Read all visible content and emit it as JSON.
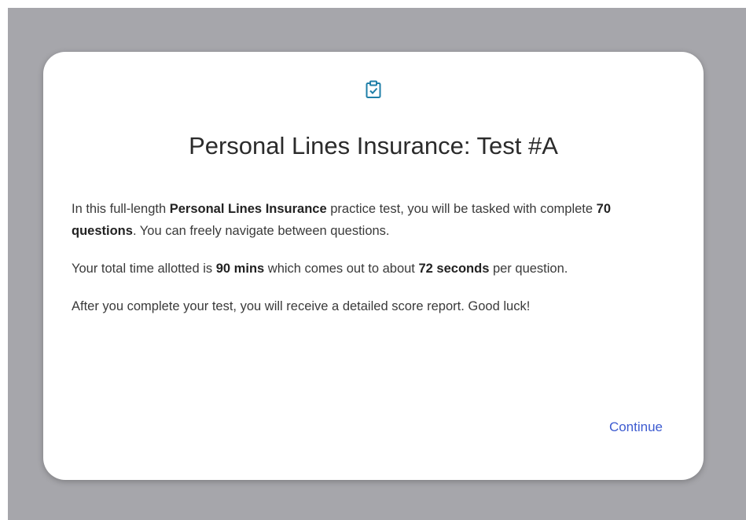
{
  "modal": {
    "icon": "clipboard-check-icon",
    "title": "Personal Lines Insurance: Test #A",
    "p1": {
      "t1": "In this full-length ",
      "b1": "Personal Lines Insurance",
      "t2": " practice test, you will be tasked with complete ",
      "b2": "70 questions",
      "t3": ". You can freely navigate between questions."
    },
    "p2": {
      "t1": "Your total time allotted is ",
      "b1": "90 mins",
      "t2": " which comes out to about ",
      "b2": "72 seconds",
      "t3": " per question."
    },
    "p3": "After you complete your test, you will receive a detailed score report. Good luck!",
    "continue_label": "Continue"
  },
  "colors": {
    "backdrop": "#a6a6ab",
    "accent": "#3d5bd0",
    "icon": "#1f7fa8"
  }
}
